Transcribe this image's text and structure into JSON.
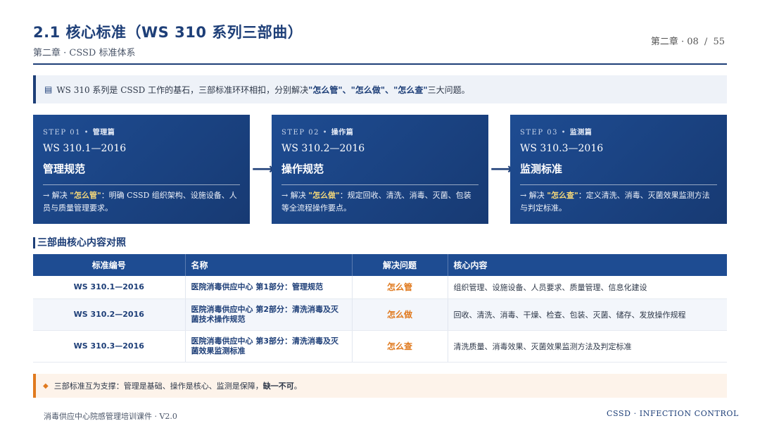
{
  "header": {
    "title": "2.1 核心标准（WS 310 系列三部曲）",
    "subtitle": "第二章 · CSSD 标准体系",
    "chapter": "第二章 · 08",
    "sep": "/",
    "total": "55"
  },
  "intro": {
    "icon": "document-icon",
    "pre": "WS 310 系列是 CSSD 工作的基石，三部标准环环相扣，分别解决",
    "hl": "\"怎么管\"、\"怎么做\"、\"怎么查\"",
    "post": "三大问题。"
  },
  "steps": [
    {
      "step": "STEP 01 • ",
      "kind": "管理篇",
      "code": "WS 310.1—2016",
      "name": "管理规范",
      "pre": "→ 解决 ",
      "q": "\"怎么管\"",
      "post": "：明确 CSSD 组织架构、设施设备、人员与质量管理要求。"
    },
    {
      "step": "STEP 02 • ",
      "kind": "操作篇",
      "code": "WS 310.2—2016",
      "name": "操作规范",
      "pre": "→ 解决 ",
      "q": "\"怎么做\"",
      "post": "：规定回收、清洗、消毒、灭菌、包装等全流程操作要点。"
    },
    {
      "step": "STEP 03 • ",
      "kind": "监测篇",
      "code": "WS 310.3—2016",
      "name": "监测标准",
      "pre": "→ 解决 ",
      "q": "\"怎么查\"",
      "post": "：定义清洗、消毒、灭菌效果监测方法与判定标准。"
    }
  ],
  "arrow_glyph": "⟶",
  "section_title": "三部曲核心内容对照",
  "table": {
    "headers": [
      "标准编号",
      "名称",
      "解决问题",
      "核心内容"
    ],
    "rows": [
      {
        "code": "WS 310.1—2016",
        "name": "医院消毒供应中心 第1部分：管理规范",
        "q": "怎么管",
        "content": "组织管理、设施设备、人员要求、质量管理、信息化建设"
      },
      {
        "code": "WS 310.2—2016",
        "name": "医院消毒供应中心 第2部分：清洗消毒及灭菌技术操作规范",
        "q": "怎么做",
        "content": "回收、清洗、消毒、干燥、检查、包装、灭菌、储存、发放操作规程"
      },
      {
        "code": "WS 310.3—2016",
        "name": "医院消毒供应中心 第3部分：清洗消毒及灭菌效果监测标准",
        "q": "怎么查",
        "content": "清洗质量、消毒效果、灭菌效果监测方法及判定标准"
      }
    ]
  },
  "note": {
    "icon": "diamond-icon",
    "text": "三部标准互为支撑：管理是基础、操作是核心、监测是保障，",
    "em": "缺一不可",
    "tail": "。"
  },
  "footer": {
    "left": "消毒供应中心院感管理培训课件 · V2.0",
    "right": "CSSD · INFECTION CONTROL"
  },
  "colors": {
    "primary": "#1e3f78",
    "accent": "#e07a1f",
    "step_bg": "#1e4c92"
  }
}
